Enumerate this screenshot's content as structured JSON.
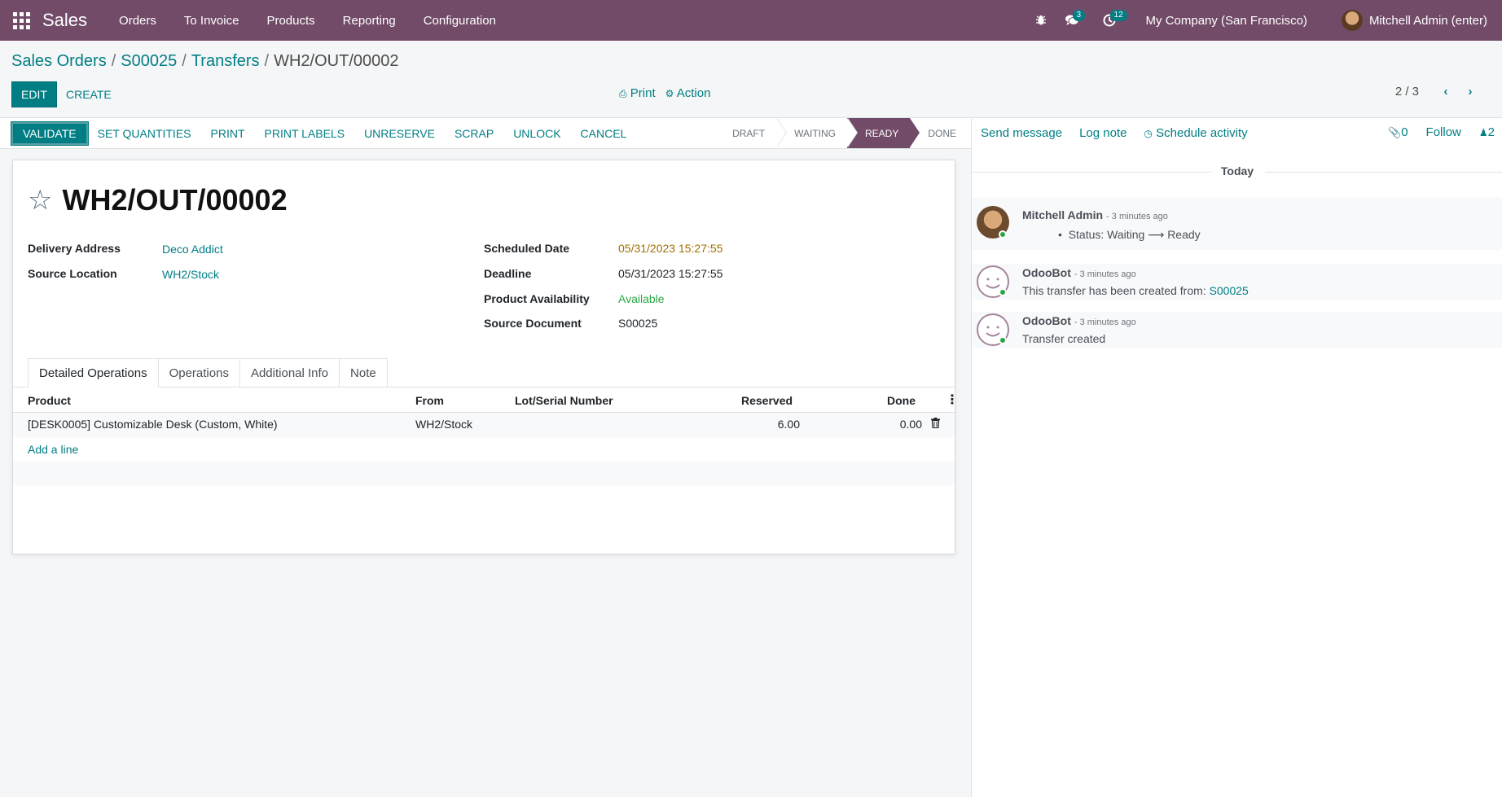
{
  "navbar": {
    "brand": "Sales",
    "menu": [
      "Orders",
      "To Invoice",
      "Products",
      "Reporting",
      "Configuration"
    ],
    "messages_count": "3",
    "activities_count": "12",
    "company": "My Company (San Francisco)",
    "user": "Mitchell Admin (enter)"
  },
  "breadcrumb": {
    "items": [
      "Sales Orders",
      "S00025",
      "Transfers"
    ],
    "current": "WH2/OUT/00002"
  },
  "controls": {
    "edit": "EDIT",
    "create": "CREATE",
    "print": "Print",
    "action": "Action",
    "pager": "2 / 3"
  },
  "statusbar": {
    "buttons": [
      "VALIDATE",
      "SET QUANTITIES",
      "PRINT",
      "PRINT LABELS",
      "UNRESERVE",
      "SCRAP",
      "UNLOCK",
      "CANCEL"
    ],
    "stages": [
      "DRAFT",
      "WAITING",
      "READY",
      "DONE"
    ],
    "active_stage": "READY"
  },
  "form": {
    "title": "WH2/OUT/00002",
    "fields": {
      "delivery_address_label": "Delivery Address",
      "delivery_address": "Deco Addict",
      "source_location_label": "Source Location",
      "source_location": "WH2/Stock",
      "scheduled_date_label": "Scheduled Date",
      "scheduled_date": "05/31/2023 15:27:55",
      "deadline_label": "Deadline",
      "deadline": "05/31/2023 15:27:55",
      "availability_label": "Product Availability",
      "availability": "Available",
      "source_document_label": "Source Document",
      "source_document": "S00025"
    },
    "tabs": [
      "Detailed Operations",
      "Operations",
      "Additional Info",
      "Note"
    ],
    "table": {
      "headers": [
        "Product",
        "From",
        "Lot/Serial Number",
        "Reserved",
        "Done"
      ],
      "rows": [
        {
          "product": "[DESK0005] Customizable Desk (Custom, White)",
          "from": "WH2/Stock",
          "lot": "",
          "reserved": "6.00",
          "done": "0.00"
        }
      ],
      "add_line": "Add a line"
    }
  },
  "chatter": {
    "send_message": "Send message",
    "log_note": "Log note",
    "schedule_activity": "Schedule activity",
    "attachments": "0",
    "follow": "Follow",
    "followers": "2",
    "date_separator": "Today",
    "messages": [
      {
        "author": "Mitchell Admin",
        "time": "- 3 minutes ago",
        "body_prefix": "Status: Waiting",
        "body_suffix": "Ready"
      },
      {
        "author": "OdooBot",
        "time": "- 3 minutes ago",
        "body": "This transfer has been created from: ",
        "body_link": "S00025"
      },
      {
        "author": "OdooBot",
        "time": "- 3 minutes ago",
        "body": "Transfer created"
      }
    ]
  },
  "colors": {
    "brand": "#714b67",
    "accent": "#017e84",
    "warning_date": "#a07000",
    "success": "#28a745"
  }
}
